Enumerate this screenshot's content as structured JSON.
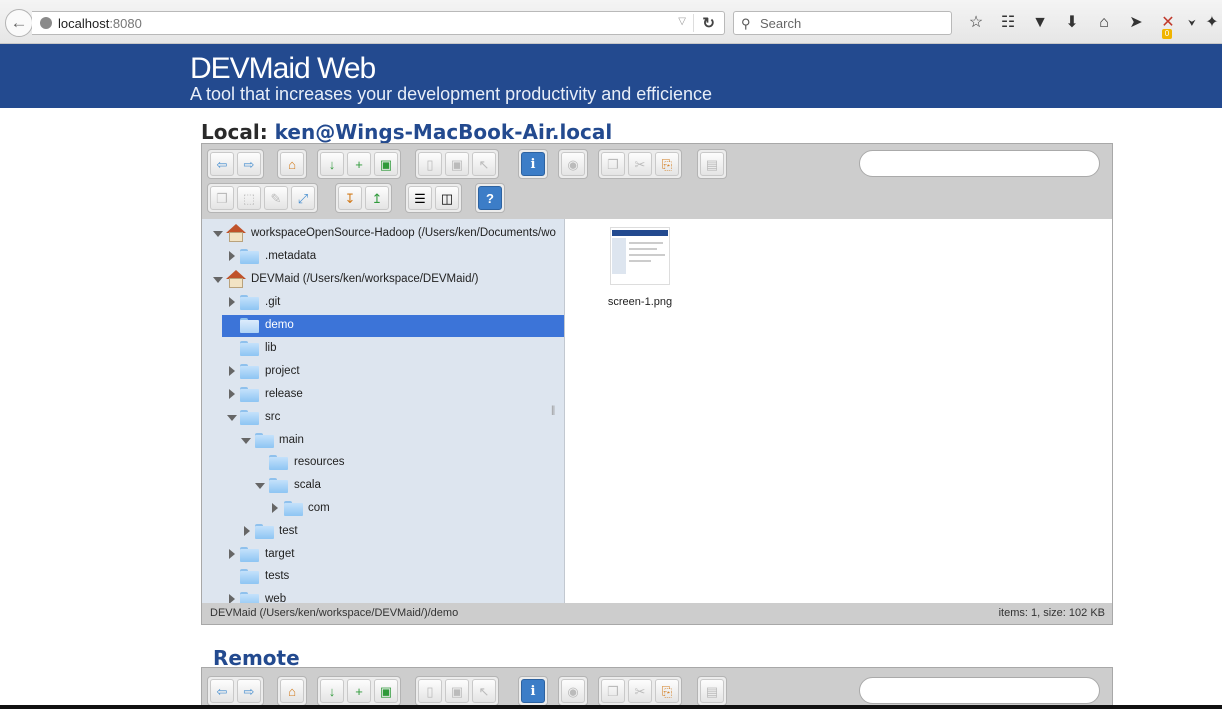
{
  "browser": {
    "url_host": "localhost",
    "url_port": ":8080",
    "search_placeholder": "Search",
    "addon_badge": "0"
  },
  "banner": {
    "title": "DEVMaid Web",
    "subtitle": "A tool that increases your development productivity and efficience"
  },
  "local": {
    "heading_prefix": "Local:",
    "heading_host": "ken@Wings-MacBook-Air.local",
    "tree": [
      {
        "label": "workspaceOpenSource-Hadoop (/Users/ken/Documents/wo",
        "icon": "home-icon",
        "expanded": true
      },
      {
        "label": ".metadata",
        "icon": "folder-icon"
      },
      {
        "label": "DEVMaid (/Users/ken/workspace/DEVMaid/)",
        "icon": "home-icon",
        "expanded": true
      },
      {
        "label": ".git",
        "icon": "folder-icon"
      },
      {
        "label": "demo",
        "icon": "folder-open-icon",
        "selected": true
      },
      {
        "label": "lib",
        "icon": "folder-icon"
      },
      {
        "label": "project",
        "icon": "folder-icon"
      },
      {
        "label": "release",
        "icon": "folder-icon"
      },
      {
        "label": "src",
        "icon": "folder-icon",
        "expanded": true
      },
      {
        "label": "main",
        "icon": "folder-icon",
        "expanded": true
      },
      {
        "label": "resources",
        "icon": "folder-icon"
      },
      {
        "label": "scala",
        "icon": "folder-icon",
        "expanded": true
      },
      {
        "label": "com",
        "icon": "folder-icon"
      },
      {
        "label": "test",
        "icon": "folder-icon"
      },
      {
        "label": "target",
        "icon": "folder-icon"
      },
      {
        "label": "tests",
        "icon": "folder-icon"
      },
      {
        "label": "web",
        "icon": "folder-icon"
      }
    ],
    "files": [
      {
        "name": "screen-1.png",
        "icon": "image-thumbnail"
      }
    ],
    "status_path": "DEVMaid (/Users/ken/workspace/DEVMaid/)/demo",
    "status_info": "items: 1, size: 102 KB"
  },
  "remote": {
    "heading": "Remote"
  },
  "toolbar_icons": {
    "back": "⇦",
    "forward": "⇨",
    "home": "⌂",
    "open": "↓",
    "new_file": "+",
    "save": "▣",
    "copy_file": "▯",
    "save2": "▣",
    "cursor": "↖",
    "info": "i",
    "preview": "◉",
    "copy": "❐",
    "cut": "✂",
    "paste": "⎘",
    "archive": "▤",
    "duplicate": "❐",
    "select": "⬚",
    "rename": "✎",
    "resize": "⤢",
    "extract": "↧",
    "compress": "↥",
    "view_list": "☰",
    "view_icons": "◫",
    "help": "?"
  },
  "chrome_icons": [
    "☆",
    "☷",
    "▼",
    "⬇",
    "⌂",
    "➤",
    "✕",
    "⮟",
    "✦"
  ]
}
